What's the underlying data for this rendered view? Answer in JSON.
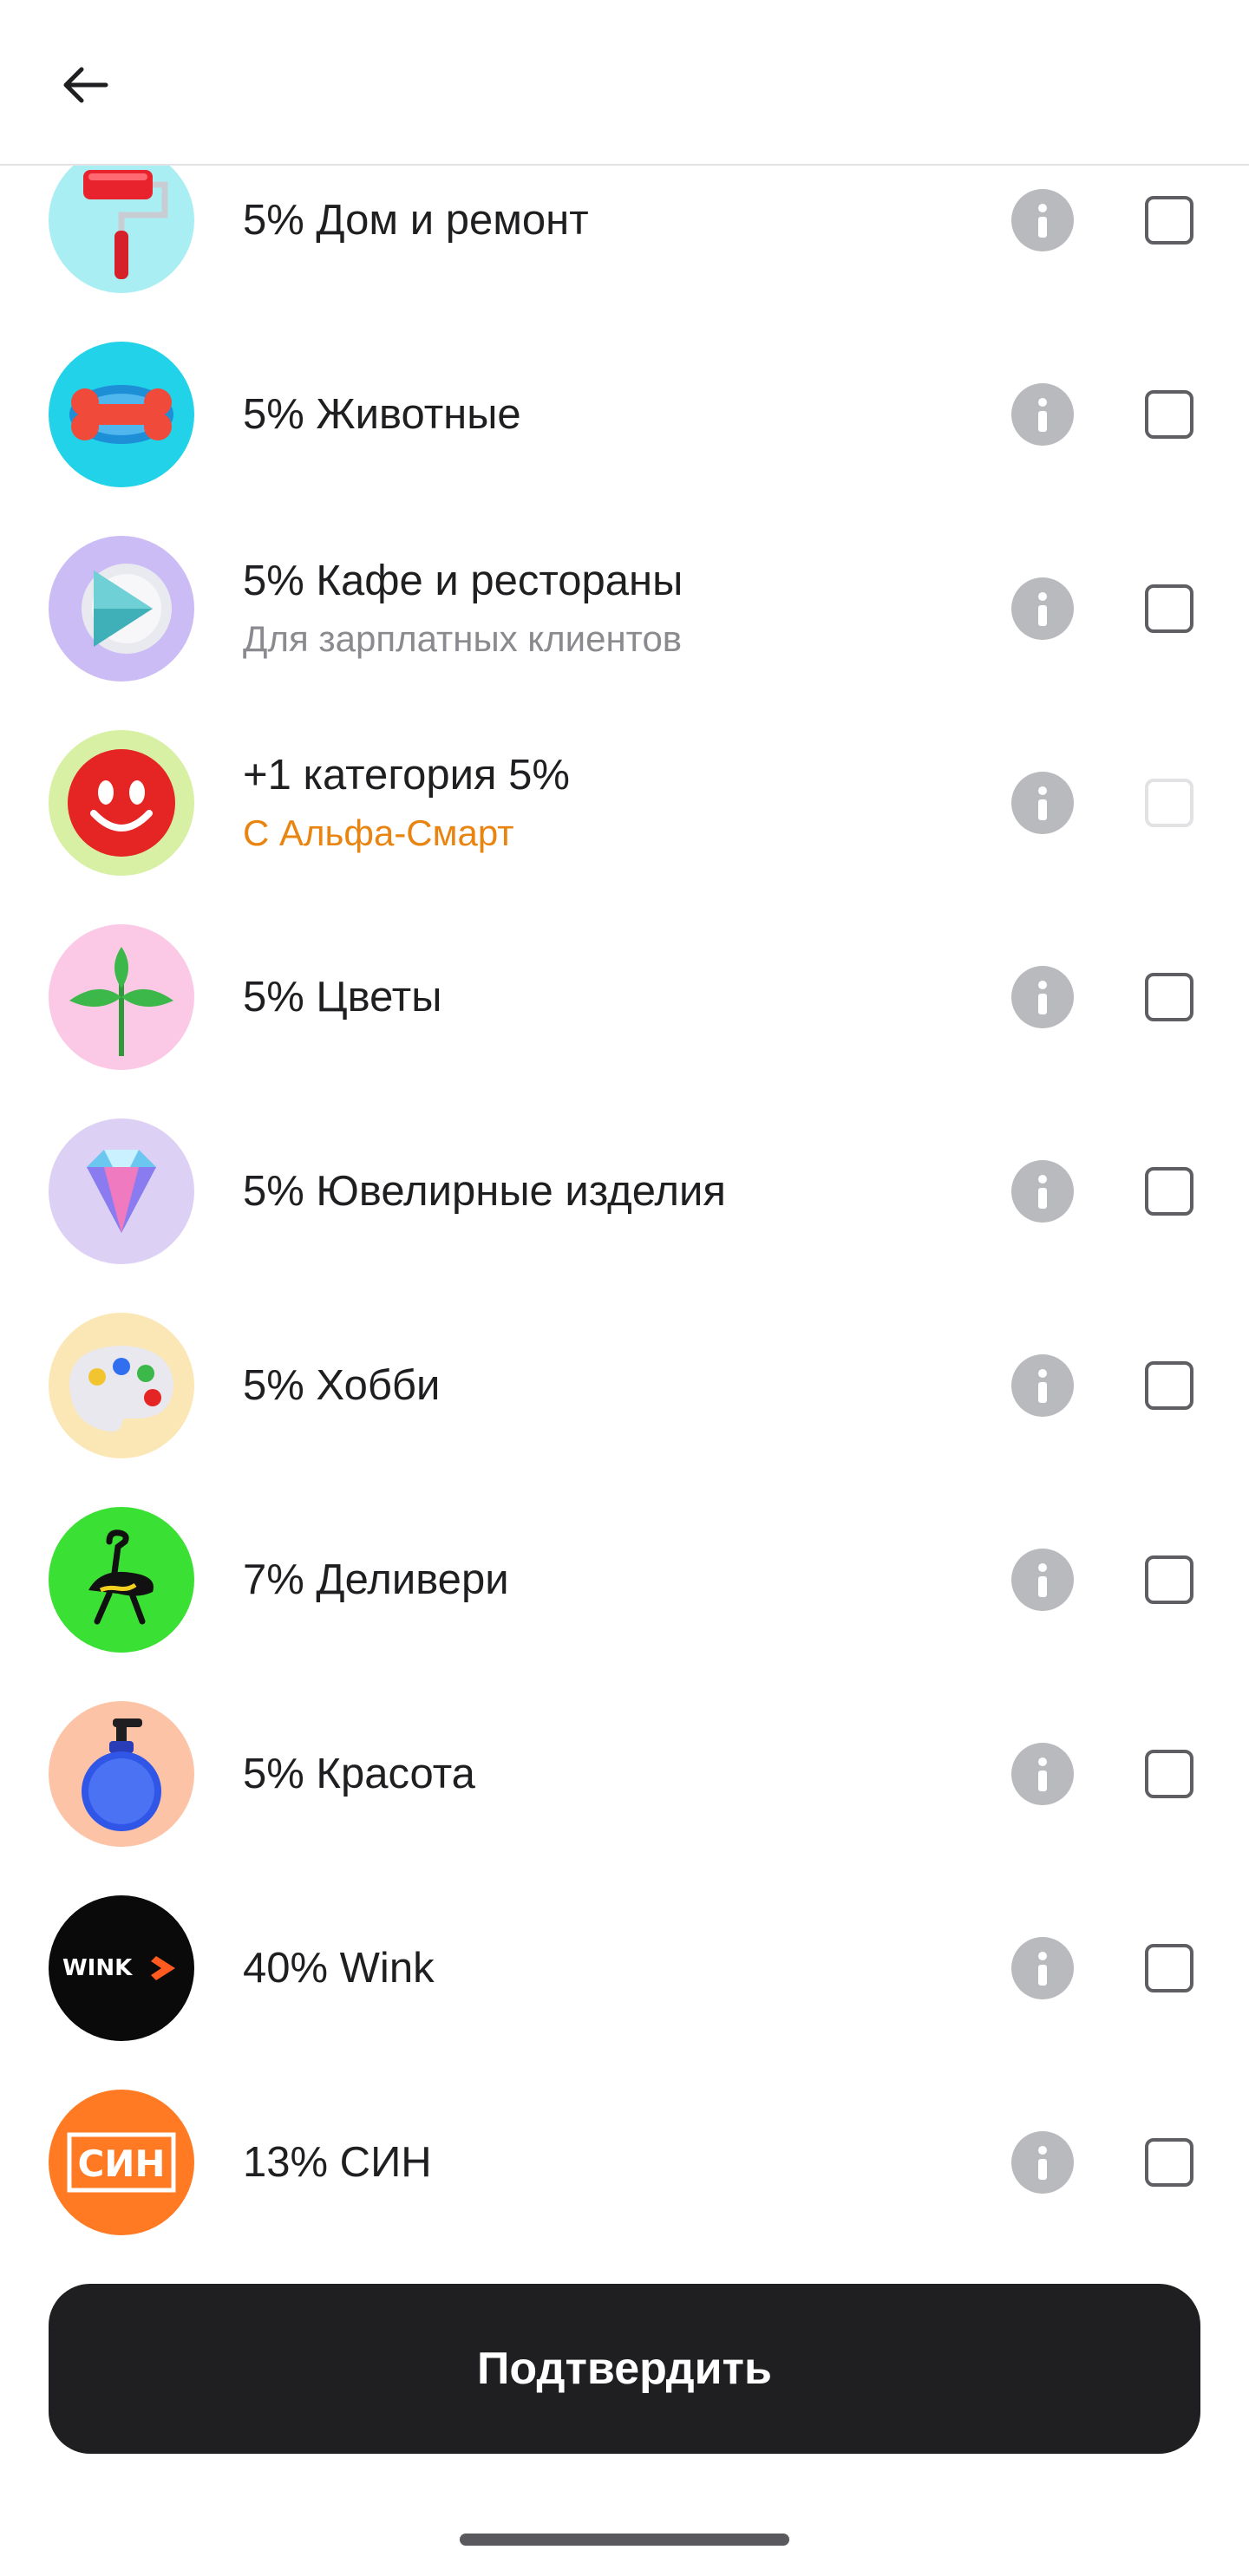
{
  "header": {
    "back_icon": "arrow-left-icon"
  },
  "colors": {
    "text_primary": "#1f1f22",
    "text_secondary": "#8a8a8f",
    "accent_orange": "#e8840f",
    "info_icon": "#b8babe",
    "button_bg": "#1f1f22"
  },
  "items": [
    {
      "title": "5% Дом и ремонт",
      "subtitle": "",
      "icon": "paint-roller-icon",
      "checked": false,
      "enabled": true
    },
    {
      "title": "5% Животные",
      "subtitle": "",
      "icon": "bone-icon",
      "checked": false,
      "enabled": true
    },
    {
      "title": "5% Кафе и рестораны",
      "subtitle": "Для зарплатных клиентов",
      "icon": "play-plate-icon",
      "checked": false,
      "enabled": true
    },
    {
      "title": "+1 категория 5%",
      "subtitle": "С Альфа-Смарт",
      "icon": "smiley-icon",
      "checked": false,
      "enabled": false
    },
    {
      "title": "5% Цветы",
      "subtitle": "",
      "icon": "sprout-icon",
      "checked": false,
      "enabled": true
    },
    {
      "title": "5% Ювелирные изделия",
      "subtitle": "",
      "icon": "diamond-icon",
      "checked": false,
      "enabled": true
    },
    {
      "title": "5% Хобби",
      "subtitle": "",
      "icon": "palette-icon",
      "checked": false,
      "enabled": true
    },
    {
      "title": "7% Деливери",
      "subtitle": "",
      "icon": "ostrich-icon",
      "checked": false,
      "enabled": true
    },
    {
      "title": "5% Красота",
      "subtitle": "",
      "icon": "soap-bottle-icon",
      "checked": false,
      "enabled": true
    },
    {
      "title": "40% Wink",
      "subtitle": "",
      "icon": "wink-logo-icon",
      "logo_text": "WINK",
      "checked": false,
      "enabled": true
    },
    {
      "title": "13% СИН",
      "subtitle": "",
      "icon": "sin-logo-icon",
      "logo_text": "СИН",
      "checked": false,
      "enabled": true
    }
  ],
  "footer": {
    "confirm_label": "Подтвердить"
  }
}
